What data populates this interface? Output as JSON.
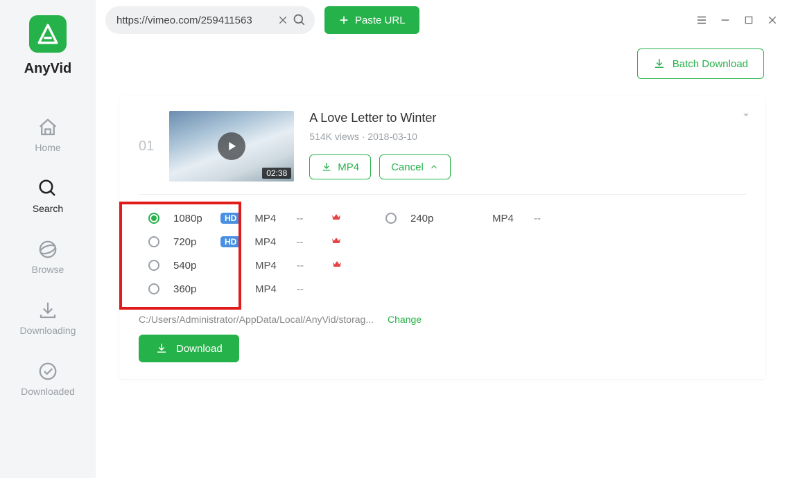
{
  "app": {
    "name": "AnyVid"
  },
  "sidebar": {
    "items": [
      {
        "label": "Home"
      },
      {
        "label": "Search"
      },
      {
        "label": "Browse"
      },
      {
        "label": "Downloading"
      },
      {
        "label": "Downloaded"
      }
    ],
    "active_index": 1
  },
  "topbar": {
    "url_value": "https://vimeo.com/259411563",
    "paste_label": "Paste URL"
  },
  "batch": {
    "label": "Batch Download"
  },
  "result": {
    "index": "01",
    "duration": "02:38",
    "title": "A Love Letter to Winter",
    "views": "514K views",
    "date": "2018-03-10",
    "mp4_label": "MP4",
    "cancel_label": "Cancel",
    "path": "C:/Users/Administrator/AppData/Local/AnyVid/storag...",
    "change_label": "Change",
    "download_label": "Download",
    "quality_left": [
      {
        "res": "1080p",
        "hd": "HD",
        "fmt": "MP4",
        "size": "--",
        "crown": true,
        "selected": true
      },
      {
        "res": "720p",
        "hd": "HD",
        "fmt": "MP4",
        "size": "--",
        "crown": true,
        "selected": false
      },
      {
        "res": "540p",
        "hd": "",
        "fmt": "MP4",
        "size": "--",
        "crown": true,
        "selected": false
      },
      {
        "res": "360p",
        "hd": "",
        "fmt": "MP4",
        "size": "--",
        "crown": false,
        "selected": false
      }
    ],
    "quality_right": [
      {
        "res": "240p",
        "hd": "",
        "fmt": "MP4",
        "size": "--",
        "crown": false,
        "selected": false
      }
    ]
  }
}
